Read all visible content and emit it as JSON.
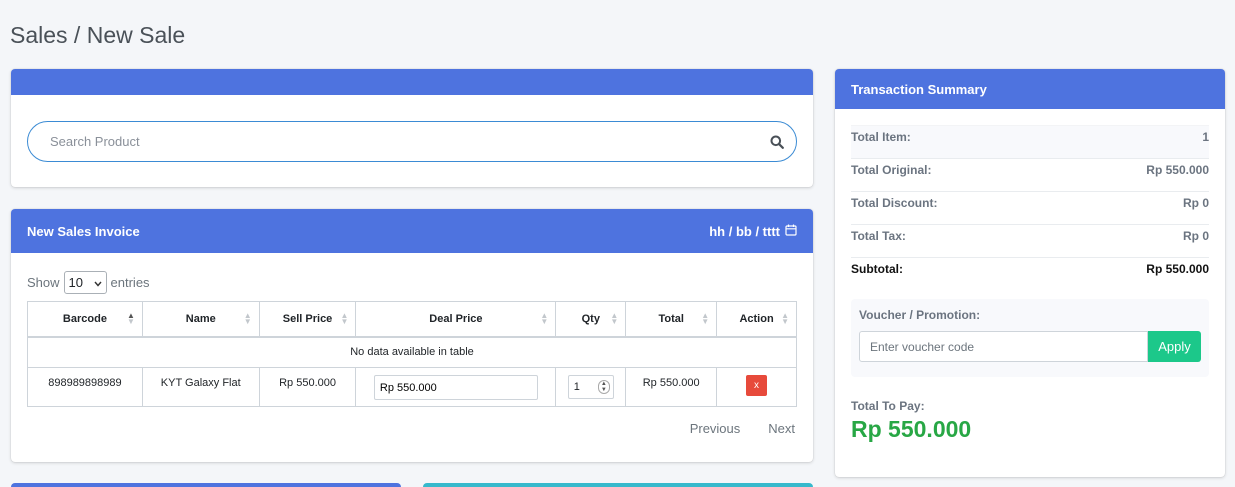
{
  "page": {
    "title": "Sales / New Sale"
  },
  "search": {
    "placeholder": "Search Product"
  },
  "invoice": {
    "title": "New Sales Invoice",
    "date_placeholder": "hh / bb / tttt",
    "length": {
      "show": "Show",
      "value": "10",
      "entries": "entries"
    },
    "columns": [
      "Barcode",
      "Name",
      "Sell Price",
      "Deal Price",
      "Qty",
      "Total",
      "Action"
    ],
    "empty_text": "No data available in table",
    "rows": [
      {
        "barcode": "898989898989",
        "name": "KYT Galaxy Flat",
        "sell_price": "Rp 550.000",
        "deal_price": "Rp 550.000",
        "qty": "1",
        "total": "Rp 550.000",
        "action": "x"
      }
    ],
    "pager": {
      "previous": "Previous",
      "next": "Next"
    }
  },
  "summary": {
    "title": "Transaction Summary",
    "rows": [
      {
        "label": "Total Item:",
        "value": "1"
      },
      {
        "label": "Total Original:",
        "value": "Rp 550.000"
      },
      {
        "label": "Total Discount:",
        "value": "Rp 0"
      },
      {
        "label": "Total Tax:",
        "value": "Rp 0"
      },
      {
        "label": "Subtotal:",
        "value": "Rp 550.000"
      }
    ],
    "voucher": {
      "label": "Voucher / Promotion:",
      "placeholder": "Enter voucher code",
      "apply": "Apply"
    },
    "pay": {
      "label": "Total To Pay:",
      "value": "Rp 550.000"
    }
  },
  "colors": {
    "primary": "#4e73df",
    "success": "#1cc88a",
    "danger": "#e74a3b",
    "pay_green": "#28a745",
    "info": "#36b9cc"
  }
}
